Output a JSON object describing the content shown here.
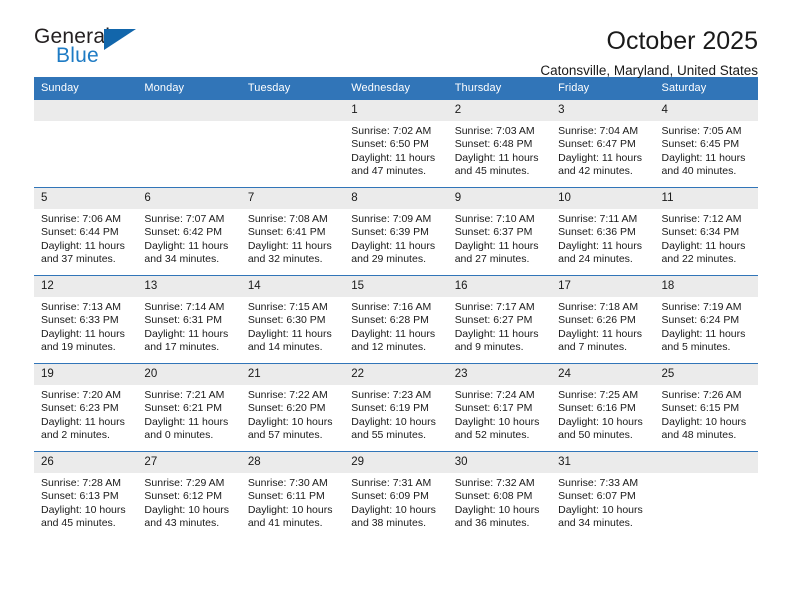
{
  "brand": {
    "name_part1": "General",
    "name_part2": "Blue"
  },
  "header": {
    "title": "October 2025",
    "location": "Catonsville, Maryland, United States"
  },
  "colors": {
    "header_blue": "#3175b8",
    "logo_blue": "#1e7bc4",
    "daynum_band": "#ebebeb"
  },
  "weekday_headers": [
    "Sunday",
    "Monday",
    "Tuesday",
    "Wednesday",
    "Thursday",
    "Friday",
    "Saturday"
  ],
  "labels": {
    "sunrise_prefix": "Sunrise:",
    "sunset_prefix": "Sunset:",
    "daylight_prefix": "Daylight:"
  },
  "weeks": [
    [
      {
        "day": "",
        "sunrise": "",
        "sunset": "",
        "daylight_line1": "",
        "daylight_line2": "",
        "empty": true
      },
      {
        "day": "",
        "sunrise": "",
        "sunset": "",
        "daylight_line1": "",
        "daylight_line2": "",
        "empty": true
      },
      {
        "day": "",
        "sunrise": "",
        "sunset": "",
        "daylight_line1": "",
        "daylight_line2": "",
        "empty": true
      },
      {
        "day": "1",
        "sunrise": "Sunrise: 7:02 AM",
        "sunset": "Sunset: 6:50 PM",
        "daylight_line1": "Daylight: 11 hours",
        "daylight_line2": "and 47 minutes.",
        "empty": false
      },
      {
        "day": "2",
        "sunrise": "Sunrise: 7:03 AM",
        "sunset": "Sunset: 6:48 PM",
        "daylight_line1": "Daylight: 11 hours",
        "daylight_line2": "and 45 minutes.",
        "empty": false
      },
      {
        "day": "3",
        "sunrise": "Sunrise: 7:04 AM",
        "sunset": "Sunset: 6:47 PM",
        "daylight_line1": "Daylight: 11 hours",
        "daylight_line2": "and 42 minutes.",
        "empty": false
      },
      {
        "day": "4",
        "sunrise": "Sunrise: 7:05 AM",
        "sunset": "Sunset: 6:45 PM",
        "daylight_line1": "Daylight: 11 hours",
        "daylight_line2": "and 40 minutes.",
        "empty": false
      }
    ],
    [
      {
        "day": "5",
        "sunrise": "Sunrise: 7:06 AM",
        "sunset": "Sunset: 6:44 PM",
        "daylight_line1": "Daylight: 11 hours",
        "daylight_line2": "and 37 minutes.",
        "empty": false
      },
      {
        "day": "6",
        "sunrise": "Sunrise: 7:07 AM",
        "sunset": "Sunset: 6:42 PM",
        "daylight_line1": "Daylight: 11 hours",
        "daylight_line2": "and 34 minutes.",
        "empty": false
      },
      {
        "day": "7",
        "sunrise": "Sunrise: 7:08 AM",
        "sunset": "Sunset: 6:41 PM",
        "daylight_line1": "Daylight: 11 hours",
        "daylight_line2": "and 32 minutes.",
        "empty": false
      },
      {
        "day": "8",
        "sunrise": "Sunrise: 7:09 AM",
        "sunset": "Sunset: 6:39 PM",
        "daylight_line1": "Daylight: 11 hours",
        "daylight_line2": "and 29 minutes.",
        "empty": false
      },
      {
        "day": "9",
        "sunrise": "Sunrise: 7:10 AM",
        "sunset": "Sunset: 6:37 PM",
        "daylight_line1": "Daylight: 11 hours",
        "daylight_line2": "and 27 minutes.",
        "empty": false
      },
      {
        "day": "10",
        "sunrise": "Sunrise: 7:11 AM",
        "sunset": "Sunset: 6:36 PM",
        "daylight_line1": "Daylight: 11 hours",
        "daylight_line2": "and 24 minutes.",
        "empty": false
      },
      {
        "day": "11",
        "sunrise": "Sunrise: 7:12 AM",
        "sunset": "Sunset: 6:34 PM",
        "daylight_line1": "Daylight: 11 hours",
        "daylight_line2": "and 22 minutes.",
        "empty": false
      }
    ],
    [
      {
        "day": "12",
        "sunrise": "Sunrise: 7:13 AM",
        "sunset": "Sunset: 6:33 PM",
        "daylight_line1": "Daylight: 11 hours",
        "daylight_line2": "and 19 minutes.",
        "empty": false
      },
      {
        "day": "13",
        "sunrise": "Sunrise: 7:14 AM",
        "sunset": "Sunset: 6:31 PM",
        "daylight_line1": "Daylight: 11 hours",
        "daylight_line2": "and 17 minutes.",
        "empty": false
      },
      {
        "day": "14",
        "sunrise": "Sunrise: 7:15 AM",
        "sunset": "Sunset: 6:30 PM",
        "daylight_line1": "Daylight: 11 hours",
        "daylight_line2": "and 14 minutes.",
        "empty": false
      },
      {
        "day": "15",
        "sunrise": "Sunrise: 7:16 AM",
        "sunset": "Sunset: 6:28 PM",
        "daylight_line1": "Daylight: 11 hours",
        "daylight_line2": "and 12 minutes.",
        "empty": false
      },
      {
        "day": "16",
        "sunrise": "Sunrise: 7:17 AM",
        "sunset": "Sunset: 6:27 PM",
        "daylight_line1": "Daylight: 11 hours",
        "daylight_line2": "and 9 minutes.",
        "empty": false
      },
      {
        "day": "17",
        "sunrise": "Sunrise: 7:18 AM",
        "sunset": "Sunset: 6:26 PM",
        "daylight_line1": "Daylight: 11 hours",
        "daylight_line2": "and 7 minutes.",
        "empty": false
      },
      {
        "day": "18",
        "sunrise": "Sunrise: 7:19 AM",
        "sunset": "Sunset: 6:24 PM",
        "daylight_line1": "Daylight: 11 hours",
        "daylight_line2": "and 5 minutes.",
        "empty": false
      }
    ],
    [
      {
        "day": "19",
        "sunrise": "Sunrise: 7:20 AM",
        "sunset": "Sunset: 6:23 PM",
        "daylight_line1": "Daylight: 11 hours",
        "daylight_line2": "and 2 minutes.",
        "empty": false
      },
      {
        "day": "20",
        "sunrise": "Sunrise: 7:21 AM",
        "sunset": "Sunset: 6:21 PM",
        "daylight_line1": "Daylight: 11 hours",
        "daylight_line2": "and 0 minutes.",
        "empty": false
      },
      {
        "day": "21",
        "sunrise": "Sunrise: 7:22 AM",
        "sunset": "Sunset: 6:20 PM",
        "daylight_line1": "Daylight: 10 hours",
        "daylight_line2": "and 57 minutes.",
        "empty": false
      },
      {
        "day": "22",
        "sunrise": "Sunrise: 7:23 AM",
        "sunset": "Sunset: 6:19 PM",
        "daylight_line1": "Daylight: 10 hours",
        "daylight_line2": "and 55 minutes.",
        "empty": false
      },
      {
        "day": "23",
        "sunrise": "Sunrise: 7:24 AM",
        "sunset": "Sunset: 6:17 PM",
        "daylight_line1": "Daylight: 10 hours",
        "daylight_line2": "and 52 minutes.",
        "empty": false
      },
      {
        "day": "24",
        "sunrise": "Sunrise: 7:25 AM",
        "sunset": "Sunset: 6:16 PM",
        "daylight_line1": "Daylight: 10 hours",
        "daylight_line2": "and 50 minutes.",
        "empty": false
      },
      {
        "day": "25",
        "sunrise": "Sunrise: 7:26 AM",
        "sunset": "Sunset: 6:15 PM",
        "daylight_line1": "Daylight: 10 hours",
        "daylight_line2": "and 48 minutes.",
        "empty": false
      }
    ],
    [
      {
        "day": "26",
        "sunrise": "Sunrise: 7:28 AM",
        "sunset": "Sunset: 6:13 PM",
        "daylight_line1": "Daylight: 10 hours",
        "daylight_line2": "and 45 minutes.",
        "empty": false
      },
      {
        "day": "27",
        "sunrise": "Sunrise: 7:29 AM",
        "sunset": "Sunset: 6:12 PM",
        "daylight_line1": "Daylight: 10 hours",
        "daylight_line2": "and 43 minutes.",
        "empty": false
      },
      {
        "day": "28",
        "sunrise": "Sunrise: 7:30 AM",
        "sunset": "Sunset: 6:11 PM",
        "daylight_line1": "Daylight: 10 hours",
        "daylight_line2": "and 41 minutes.",
        "empty": false
      },
      {
        "day": "29",
        "sunrise": "Sunrise: 7:31 AM",
        "sunset": "Sunset: 6:09 PM",
        "daylight_line1": "Daylight: 10 hours",
        "daylight_line2": "and 38 minutes.",
        "empty": false
      },
      {
        "day": "30",
        "sunrise": "Sunrise: 7:32 AM",
        "sunset": "Sunset: 6:08 PM",
        "daylight_line1": "Daylight: 10 hours",
        "daylight_line2": "and 36 minutes.",
        "empty": false
      },
      {
        "day": "31",
        "sunrise": "Sunrise: 7:33 AM",
        "sunset": "Sunset: 6:07 PM",
        "daylight_line1": "Daylight: 10 hours",
        "daylight_line2": "and 34 minutes.",
        "empty": false
      },
      {
        "day": "",
        "sunrise": "",
        "sunset": "",
        "daylight_line1": "",
        "daylight_line2": "",
        "empty": true
      }
    ]
  ]
}
